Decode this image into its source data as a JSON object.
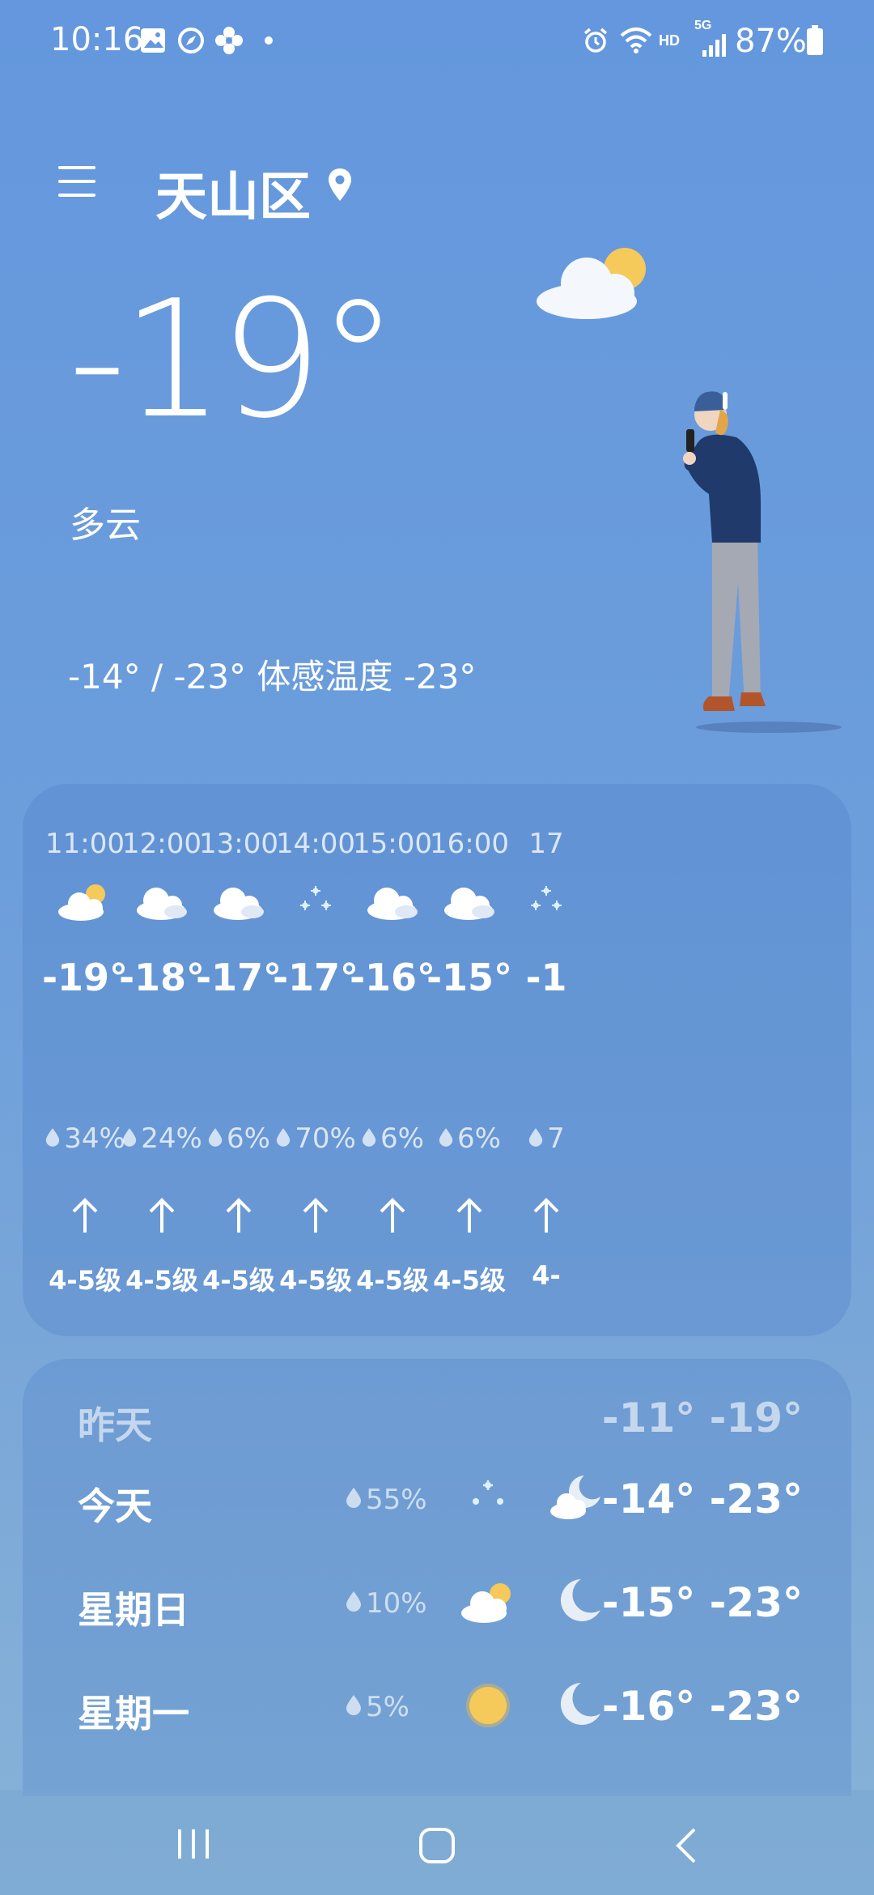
{
  "status_bar": {
    "time": "10:16",
    "battery": "87%",
    "network": "HD",
    "signal": "5G"
  },
  "header": {
    "city": "天山区"
  },
  "current": {
    "temp": "-19°",
    "condition": "多云",
    "range_text": "-14° / -23° 体感温度 -23°"
  },
  "hourly": [
    {
      "time": "11:00",
      "icon": "cloud-sun-icon",
      "temp": "-19°",
      "precip": "34%",
      "wind": "4-5级"
    },
    {
      "time": "12:00",
      "icon": "cloud-icon",
      "temp": "-18°",
      "precip": "24%",
      "wind": "4-5级"
    },
    {
      "time": "13:00",
      "icon": "cloud-icon",
      "temp": "-17°",
      "precip": "6%",
      "wind": "4-5级"
    },
    {
      "time": "14:00",
      "icon": "snow-icon",
      "temp": "-17°",
      "precip": "70%",
      "wind": "4-5级"
    },
    {
      "time": "15:00",
      "icon": "cloud-icon",
      "temp": "-16°",
      "precip": "6%",
      "wind": "4-5级"
    },
    {
      "time": "16:00",
      "icon": "cloud-icon",
      "temp": "-15°",
      "precip": "6%",
      "wind": "4-5级"
    },
    {
      "time": "17",
      "icon": "snow-icon",
      "temp": "-1",
      "precip": "7",
      "wind": "4-"
    }
  ],
  "daily": [
    {
      "day": "昨天",
      "precip": "",
      "day_icon": "",
      "night_icon": "",
      "temps": "-11° -19°"
    },
    {
      "day": "今天",
      "precip": "55%",
      "day_icon": "snow-icon",
      "night_icon": "cloud-moon-icon",
      "temps": "-14° -23°"
    },
    {
      "day": "星期日",
      "precip": "10%",
      "day_icon": "cloud-sun-icon",
      "night_icon": "moon-icon",
      "temps": "-15° -23°"
    },
    {
      "day": "星期一",
      "precip": "5%",
      "day_icon": "sun-icon",
      "night_icon": "moon-icon",
      "temps": "-16° -23°"
    }
  ],
  "colors": {
    "background": "#6497dd",
    "sun": "#f5c95a",
    "card": "#5a86c8"
  }
}
